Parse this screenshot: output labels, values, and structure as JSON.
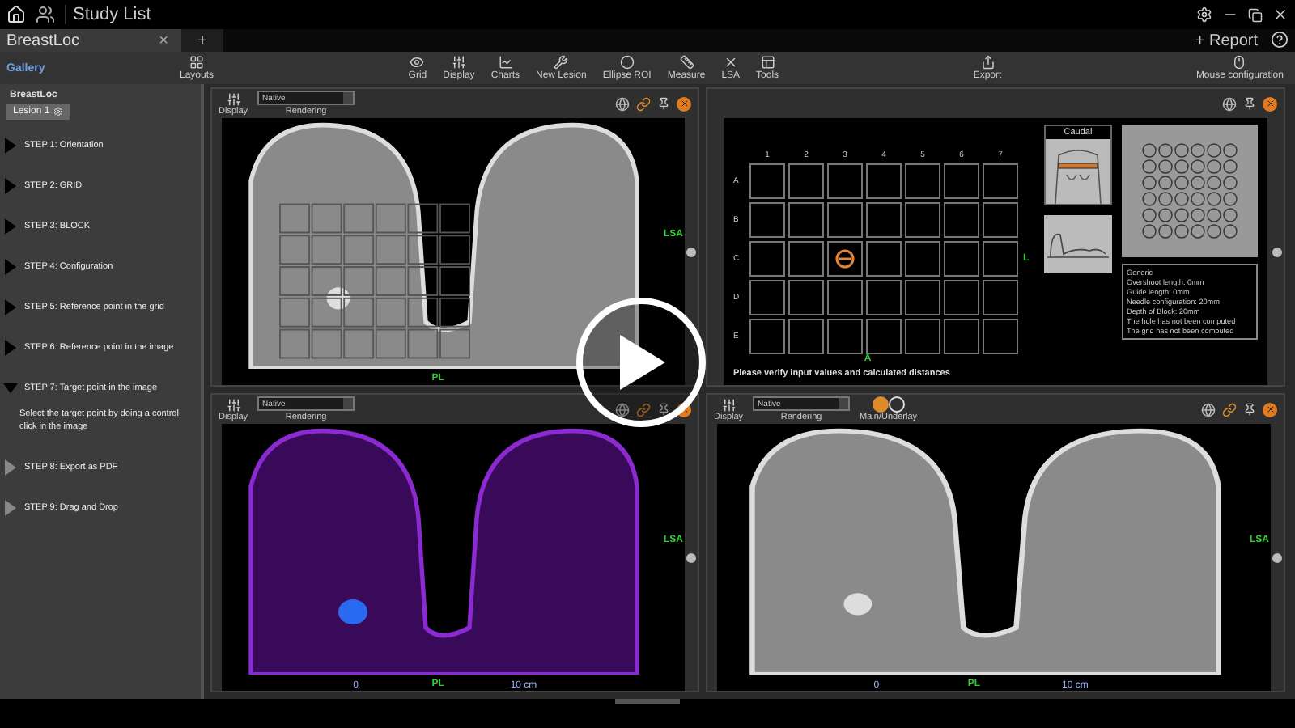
{
  "top_bar": {
    "title": "Study List"
  },
  "doc_tab": {
    "label": "BreastLoc",
    "close": "×",
    "add": "+"
  },
  "report": "+ Report",
  "toolbar": {
    "gallery": "Gallery",
    "tools": [
      {
        "label": "Layouts"
      },
      {
        "label": "Grid"
      },
      {
        "label": "Display"
      },
      {
        "label": "Charts"
      },
      {
        "label": "New Lesion"
      },
      {
        "label": "Ellipse ROI"
      },
      {
        "label": "Measure"
      },
      {
        "label": "LSA"
      },
      {
        "label": "Tools"
      },
      {
        "label": "Export"
      },
      {
        "label": "Mouse configuration"
      }
    ]
  },
  "sidebar": {
    "tree_label": "BreastLoc",
    "lesion_tab": "Lesion 1",
    "steps": [
      {
        "label": "STEP 1: Orientation",
        "expanded": false,
        "disabled": false
      },
      {
        "label": "STEP 2: GRID",
        "expanded": false,
        "disabled": false
      },
      {
        "label": "STEP 3: BLOCK",
        "expanded": false,
        "disabled": false
      },
      {
        "label": "STEP 4: Configuration",
        "expanded": false,
        "disabled": false
      },
      {
        "label": "STEP 5: Reference point in the grid",
        "expanded": false,
        "disabled": false
      },
      {
        "label": "STEP 6: Reference point in the image",
        "expanded": false,
        "disabled": false
      },
      {
        "label": "STEP 7: Target point in the image",
        "expanded": true,
        "disabled": false,
        "description": "Select the target point by doing a control click in the image"
      },
      {
        "label": "STEP 8: Export as PDF",
        "expanded": false,
        "disabled": true
      },
      {
        "label": "STEP 9: Drag and Drop",
        "expanded": false,
        "disabled": true
      }
    ]
  },
  "viewports": [
    {
      "kind": "scan",
      "colorized": false,
      "display_label": "Display",
      "rendering": "Native",
      "rendering_label": "Rendering",
      "grid_overlay": true,
      "side_label": "LSA",
      "bottom_label": "PL"
    },
    {
      "kind": "grid-panel",
      "columns": [
        "1",
        "2",
        "3",
        "4",
        "5",
        "6",
        "7"
      ],
      "rows": [
        {
          "label": "A",
          "marked": [
            false,
            false,
            false,
            false,
            false,
            false,
            false
          ]
        },
        {
          "label": "B",
          "marked": [
            false,
            false,
            false,
            false,
            false,
            false,
            false
          ]
        },
        {
          "label": "C",
          "marked": [
            false,
            false,
            true,
            false,
            false,
            false,
            false
          ]
        },
        {
          "label": "D",
          "marked": [
            false,
            false,
            false,
            false,
            false,
            false,
            false
          ]
        },
        {
          "label": "E",
          "marked": [
            false,
            false,
            false,
            false,
            false,
            false,
            false
          ]
        }
      ],
      "orientation_right": "L",
      "orientation_bottom": "A",
      "view_label": "Caudal",
      "info": [
        "Generic",
        "Overshoot length: 0mm",
        "Guide length: 0mm",
        "Needle configuration: 20mm",
        "Depth of Block: 20mm",
        "The hole has not been computed",
        "The grid has not been computed"
      ],
      "warning": "Please verify input values and calculated distances"
    },
    {
      "kind": "scan",
      "colorized": true,
      "display_label": "Display",
      "rendering": "Native",
      "rendering_label": "Rendering",
      "grid_overlay": false,
      "side_label": "LSA",
      "bottom_label": "PL",
      "scale_start": "0",
      "scale_end": "10 cm"
    },
    {
      "kind": "scan",
      "colorized": false,
      "display_label": "Display",
      "rendering": "Native",
      "rendering_label": "Rendering",
      "grid_overlay": false,
      "side_label": "LSA",
      "bottom_label": "PL",
      "scale_start": "0",
      "scale_end": "10 cm",
      "toggle": {
        "label": "Main/Underlay",
        "on": true
      }
    }
  ]
}
